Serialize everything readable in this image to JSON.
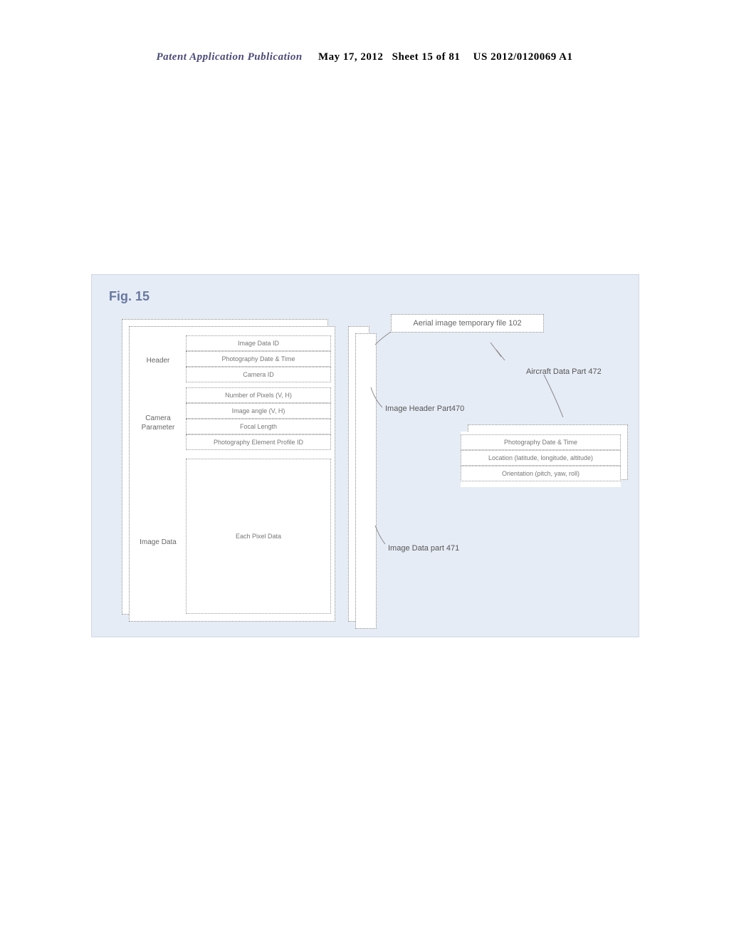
{
  "header": {
    "pub_label": "Patent Application Publication",
    "date": "May 17, 2012",
    "sheet": "Sheet 15 of 81",
    "pubnum": "US 2012/0120069 A1"
  },
  "figure": {
    "label": "Fig. 15",
    "top_caption": "Aerial image temporary file 102",
    "left_sections": {
      "header": "Header",
      "camera": "Camera Parameter",
      "imagedata": "Image Data"
    },
    "left_rows": {
      "r1": "Image Data ID",
      "r2": "Photography Date & Time",
      "r3": "Camera ID",
      "r4": "Number of Pixels (V, H)",
      "r5": "Image angle (V, H)",
      "r6": "Focal Length",
      "r7": "Photography Element Profile ID",
      "big": "Each Pixel Data"
    },
    "annotations": {
      "aircraft": "Aircraft Data Part 472",
      "image_header": "Image Header Part470",
      "image_data": "Image Data part  471"
    },
    "aircraft_rows": {
      "a1": "Photography Date & Time",
      "a2": "Location (latitude, longitude, altitude)",
      "a3": "Orientation (pitch, yaw, roll)"
    }
  }
}
